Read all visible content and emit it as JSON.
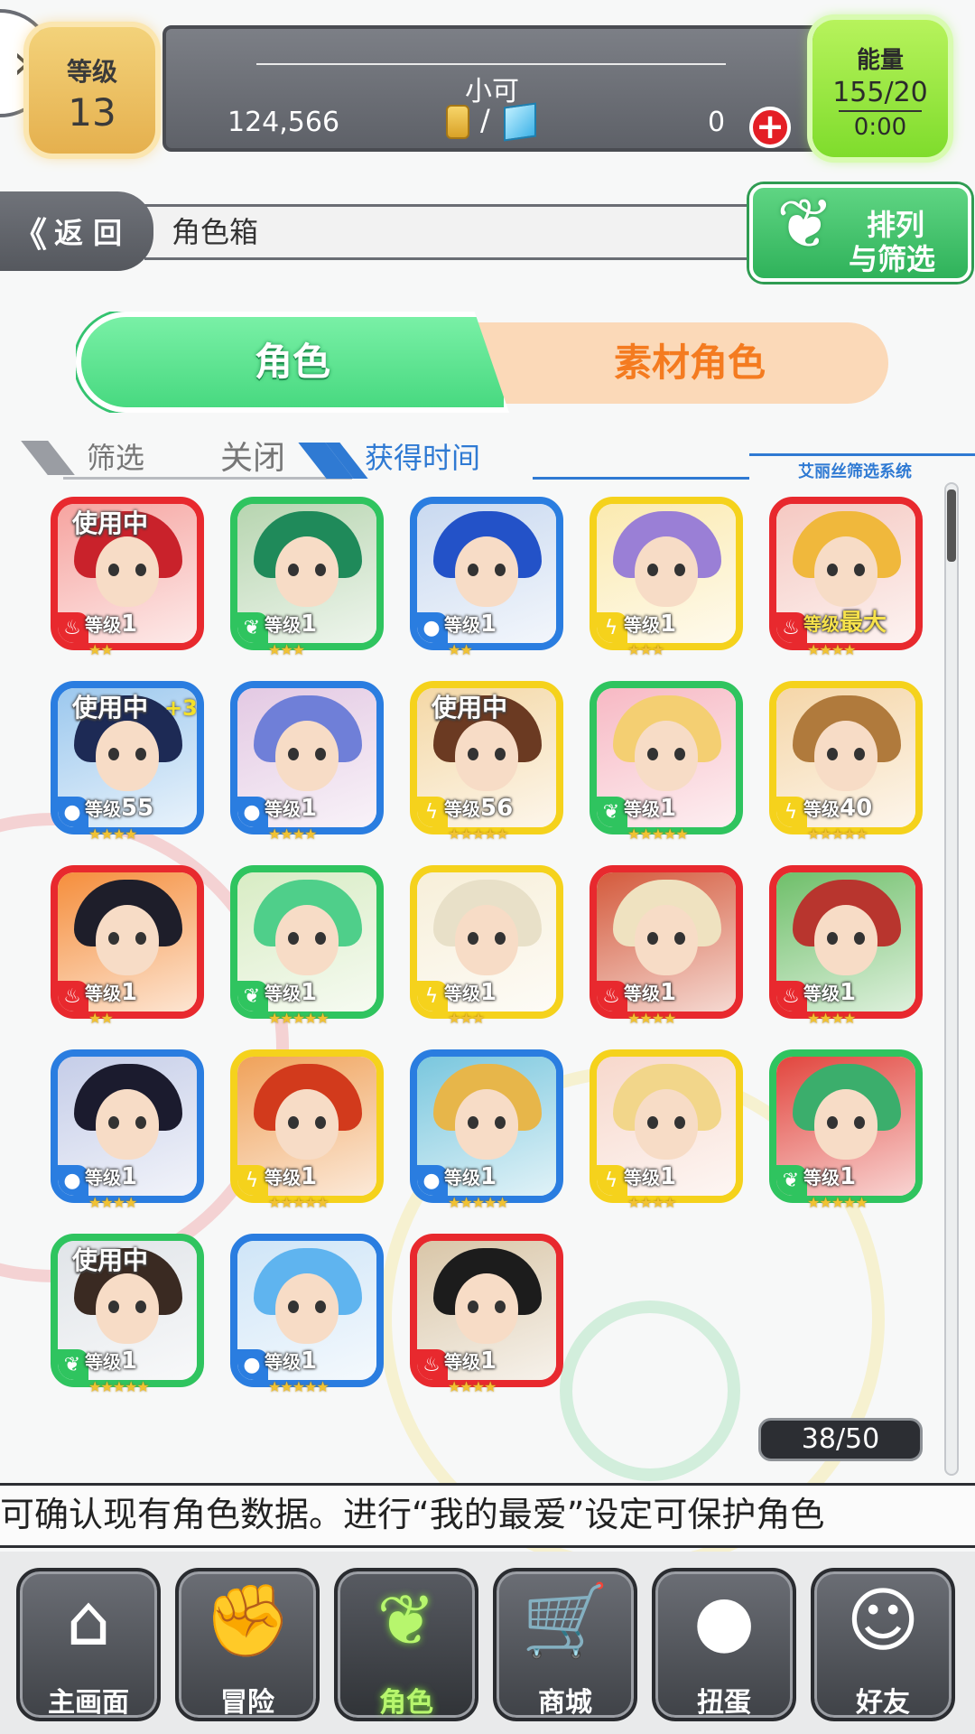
{
  "player": {
    "level_label": "等级",
    "level": "13",
    "name": "小可",
    "gold": "124,566",
    "slash": "/",
    "gems": "0",
    "add_symbol": "+",
    "energy_label": "能量",
    "energy": "155/20",
    "energy_timer": "0:00"
  },
  "nav": {
    "back_label": "返 回",
    "back_arrows": "《",
    "title": "角色箱",
    "sort_line1": "排列",
    "sort_line2": "与筛选",
    "sort_icon": "rabbit-icon"
  },
  "tabs": {
    "characters": "角色",
    "materials": "素材角色"
  },
  "filter": {
    "label": "筛选",
    "value": "关闭",
    "sort_label": "获得时间",
    "system_label": "艾丽丝筛选系统"
  },
  "colors": {
    "fire": "#e8292e",
    "wood": "#2fc45f",
    "water": "#2a7de0",
    "thunder": "#f5d21c"
  },
  "characters": [
    {
      "element": "fire",
      "in_use": "使用中",
      "bonus": "",
      "level_prefix": "等级",
      "level": "1",
      "stars": "★★",
      "hair": "#c9222b",
      "bg": "#f6a4a0"
    },
    {
      "element": "wood",
      "in_use": "",
      "bonus": "",
      "level_prefix": "等级",
      "level": "1",
      "stars": "★★★",
      "hair": "#1f8a5a",
      "bg": "#b7d5b0"
    },
    {
      "element": "water",
      "in_use": "",
      "bonus": "",
      "level_prefix": "等级",
      "level": "1",
      "stars": "★★",
      "hair": "#2352c8",
      "bg": "#c9d9f0"
    },
    {
      "element": "thunder",
      "in_use": "",
      "bonus": "",
      "level_prefix": "等级",
      "level": "1",
      "stars": "★★★",
      "hair": "#9a7fd6",
      "bg": "#fbeab0"
    },
    {
      "element": "fire",
      "in_use": "",
      "bonus": "",
      "level_prefix": "等级",
      "level": "最大",
      "stars": "★★★★",
      "hair": "#f0b83c",
      "bg": "#f5c9c2",
      "max": true
    },
    {
      "element": "water",
      "in_use": "使用中",
      "bonus": "+3",
      "level_prefix": "等级",
      "level": "55",
      "stars": "★★★★",
      "hair": "#1d2a55",
      "bg": "#9cc8ee"
    },
    {
      "element": "water",
      "in_use": "",
      "bonus": "",
      "level_prefix": "等级",
      "level": "1",
      "stars": "★★★★",
      "hair": "#6f7fd8",
      "bg": "#e3c9e3"
    },
    {
      "element": "thunder",
      "in_use": "使用中",
      "bonus": "",
      "level_prefix": "等级",
      "level": "56",
      "stars": "★★★★★",
      "hair": "#6b3a22",
      "bg": "#f4d8a6"
    },
    {
      "element": "wood",
      "in_use": "",
      "bonus": "",
      "level_prefix": "等级",
      "level": "1",
      "stars": "★★★★★",
      "hair": "#f4cf72",
      "bg": "#f7b9c4"
    },
    {
      "element": "thunder",
      "in_use": "",
      "bonus": "",
      "level_prefix": "等级",
      "level": "40",
      "stars": "★★★★★",
      "hair": "#b07a3c",
      "bg": "#f5d6a8"
    },
    {
      "element": "fire",
      "in_use": "",
      "bonus": "",
      "level_prefix": "等级",
      "level": "1",
      "stars": "★★",
      "hair": "#1e1e2a",
      "bg": "#f58e3c"
    },
    {
      "element": "wood",
      "in_use": "",
      "bonus": "",
      "level_prefix": "等级",
      "level": "1",
      "stars": "★★★★★",
      "hair": "#4fcf8a",
      "bg": "#d8ecc4"
    },
    {
      "element": "thunder",
      "in_use": "",
      "bonus": "",
      "level_prefix": "等级",
      "level": "1",
      "stars": "★★★",
      "hair": "#e8e0c8",
      "bg": "#f7efd9"
    },
    {
      "element": "fire",
      "in_use": "",
      "bonus": "",
      "level_prefix": "等级",
      "level": "1",
      "stars": "★★★★",
      "hair": "#efe2c0",
      "bg": "#d45a3c"
    },
    {
      "element": "fire",
      "in_use": "",
      "bonus": "",
      "level_prefix": "等级",
      "level": "1",
      "stars": "★★★★",
      "hair": "#b8352e",
      "bg": "#6fbf6a"
    },
    {
      "element": "water",
      "in_use": "",
      "bonus": "",
      "level_prefix": "等级",
      "level": "1",
      "stars": "★★★★",
      "hair": "#1b1b2e",
      "bg": "#c5cde8"
    },
    {
      "element": "thunder",
      "in_use": "",
      "bonus": "",
      "level_prefix": "等级",
      "level": "1",
      "stars": "★★★★★",
      "hair": "#d23a1c",
      "bg": "#f0a25a"
    },
    {
      "element": "water",
      "in_use": "",
      "bonus": "",
      "level_prefix": "等级",
      "level": "1",
      "stars": "★★★★★",
      "hair": "#e7b64a",
      "bg": "#7ac7de"
    },
    {
      "element": "thunder",
      "in_use": "",
      "bonus": "",
      "level_prefix": "等级",
      "level": "1",
      "stars": "★★★★",
      "hair": "#f2d68a",
      "bg": "#f7d8cc"
    },
    {
      "element": "wood",
      "in_use": "",
      "bonus": "",
      "level_prefix": "等级",
      "level": "1",
      "stars": "★★★★★",
      "hair": "#3bae6c",
      "bg": "#e2463e"
    },
    {
      "element": "wood",
      "in_use": "使用中",
      "bonus": "",
      "level_prefix": "等级",
      "level": "1",
      "stars": "★★★★★",
      "hair": "#3a2a22",
      "bg": "#e0e4e8"
    },
    {
      "element": "water",
      "in_use": "",
      "bonus": "",
      "level_prefix": "等级",
      "level": "1",
      "stars": "★★★★★",
      "hair": "#5fb4ef",
      "bg": "#cfe5f7"
    },
    {
      "element": "fire",
      "in_use": "",
      "bonus": "",
      "level_prefix": "等级",
      "level": "1",
      "stars": "★★★★",
      "hair": "#1c1c1c",
      "bg": "#d9c6a8"
    }
  ],
  "box_count": "38/50",
  "ticker": "可确认现有角色数据。进行“我的最爱”设定可保护角色",
  "bottom_nav": [
    {
      "label": "主画面",
      "icon": "home-icon",
      "glyph": "⌂",
      "active": false
    },
    {
      "label": "冒险",
      "icon": "handshake-icon",
      "glyph": "✊",
      "active": false
    },
    {
      "label": "角色",
      "icon": "rabbit-icon",
      "glyph": "❦",
      "active": true
    },
    {
      "label": "商城",
      "icon": "cart-icon",
      "glyph": "🛒",
      "active": false
    },
    {
      "label": "扭蛋",
      "icon": "egg-icon",
      "glyph": "●",
      "active": false
    },
    {
      "label": "好友",
      "icon": "friends-icon",
      "glyph": "☺",
      "active": false
    }
  ]
}
